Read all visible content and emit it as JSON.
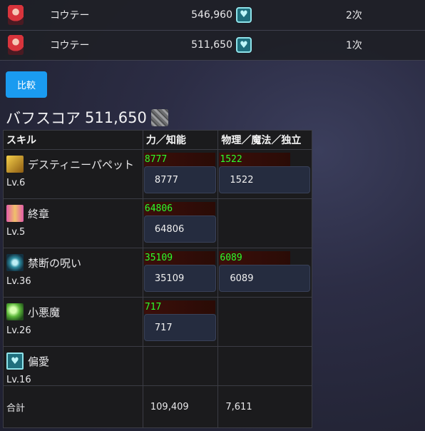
{
  "top_rows": [
    {
      "name": "コウテー",
      "score": "546,960",
      "rank": "2次"
    },
    {
      "name": "コウテー",
      "score": "511,650",
      "rank": "1次"
    }
  ],
  "compare_button": "比較",
  "buff_score": {
    "label": "バフスコア",
    "value": "511,650"
  },
  "table": {
    "headers": [
      "スキル",
      "力／知能",
      "物理／魔法／独立"
    ],
    "rows": [
      {
        "name": "デスティニーパペット",
        "level": "Lv.6",
        "icon": "destiny-puppet-icon",
        "a_gauge": "8777",
        "a_value": "8777",
        "b_gauge": "1522",
        "b_value": "1522"
      },
      {
        "name": "終章",
        "level": "Lv.5",
        "icon": "final-chapter-icon",
        "a_gauge": "64806",
        "a_value": "64806",
        "b_gauge": "",
        "b_value": ""
      },
      {
        "name": "禁断の呪い",
        "level": "Lv.36",
        "icon": "forbidden-curse-icon",
        "a_gauge": "35109",
        "a_value": "35109",
        "b_gauge": "6089",
        "b_value": "6089"
      },
      {
        "name": "小悪魔",
        "level": "Lv.26",
        "icon": "little-devil-icon",
        "a_gauge": "717",
        "a_value": "717",
        "b_gauge": "",
        "b_value": ""
      },
      {
        "name": "偏愛",
        "level": "Lv.16",
        "icon": "heart-icon",
        "a_gauge": "",
        "a_value": "",
        "b_gauge": "",
        "b_value": ""
      }
    ],
    "total": {
      "label": "合計",
      "a": "109,409",
      "b": "7,611"
    }
  },
  "colors": {
    "button": "#1a9bf0",
    "gauge_text": "#2cff2c",
    "value_box": "#252c3f"
  }
}
